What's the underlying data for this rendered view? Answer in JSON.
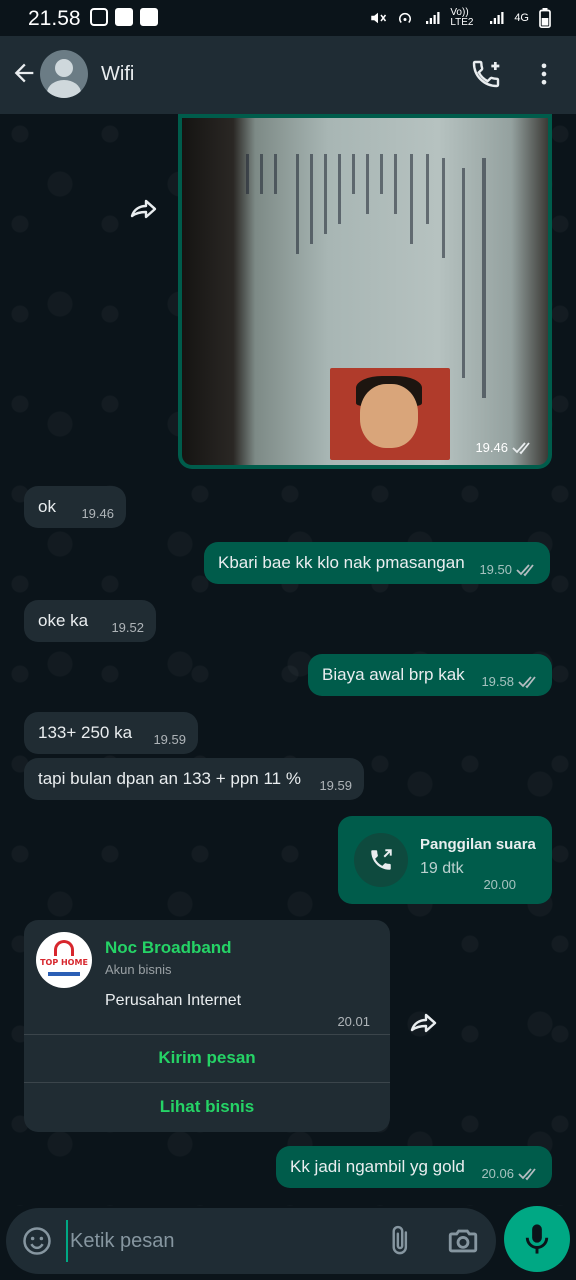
{
  "status_bar": {
    "time": "21.58",
    "network_label": "Vo)) LTE2",
    "network_type": "4G"
  },
  "header": {
    "back_icon": "arrow-left-icon",
    "contact_name": "Wifi",
    "call_icon": "add-call-icon",
    "menu_icon": "more-vert-icon"
  },
  "messages": [
    {
      "type": "image",
      "direction": "out",
      "time": "19.46"
    },
    {
      "type": "text",
      "direction": "in",
      "text": "ok",
      "time": "19.46"
    },
    {
      "type": "text",
      "direction": "out",
      "text": "Kbari bae kk klo nak pmasangan",
      "time": "19.50"
    },
    {
      "type": "text",
      "direction": "in",
      "text": "oke ka",
      "time": "19.52"
    },
    {
      "type": "text",
      "direction": "out",
      "text": "Biaya awal brp kak",
      "time": "19.58"
    },
    {
      "type": "text",
      "direction": "in",
      "text": "133+ 250 ka",
      "time": "19.59"
    },
    {
      "type": "text",
      "direction": "in",
      "text": "tapi bulan dpan an 133 + ppn 11 %",
      "time": "19.59"
    },
    {
      "type": "call",
      "direction": "out",
      "title": "Panggilan suara",
      "duration": "19 dtk",
      "time": "20.00"
    },
    {
      "type": "business_card",
      "direction": "in",
      "name": "Noc Broadband",
      "account_type": "Akun bisnis",
      "description": "Perusahan Internet",
      "time": "20.01",
      "logo_text": "TOP HOME",
      "buttons": [
        "Kirim pesan",
        "Lihat bisnis"
      ]
    },
    {
      "type": "text",
      "direction": "out",
      "text": "Kk jadi ngambil yg gold",
      "time": "20.06"
    }
  ],
  "composer": {
    "placeholder": "Ketik pesan",
    "value": ""
  },
  "colors": {
    "background": "#0b141a",
    "header": "#1f2c34",
    "incoming": "#202c33",
    "outgoing": "#005c4b",
    "accent": "#00a884",
    "link_green": "#25d366"
  }
}
